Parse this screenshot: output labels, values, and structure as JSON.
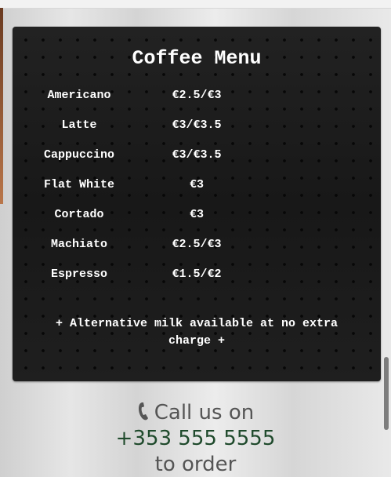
{
  "menu": {
    "title": "Coffee Menu",
    "items": [
      {
        "name": "Americano",
        "price": "€2.5/€3"
      },
      {
        "name": "Latte",
        "price": "€3/€3.5"
      },
      {
        "name": "Cappuccino",
        "price": "€3/€3.5"
      },
      {
        "name": "Flat White",
        "price": "€3"
      },
      {
        "name": "Cortado",
        "price": "€3"
      },
      {
        "name": "Machiato",
        "price": "€2.5/€3"
      },
      {
        "name": "Espresso",
        "price": "€1.5/€2"
      }
    ],
    "note": "+ Alternative milk available at no extra charge +"
  },
  "contact": {
    "icon": "phone-icon",
    "call_text": "Call us on",
    "phone": "+353 555 5555",
    "order_text": "to order"
  },
  "colors": {
    "board": "#1b1b1b",
    "text_on_board": "#ffffff",
    "contact_text": "#555555",
    "phone_number": "#1f4a2c"
  }
}
